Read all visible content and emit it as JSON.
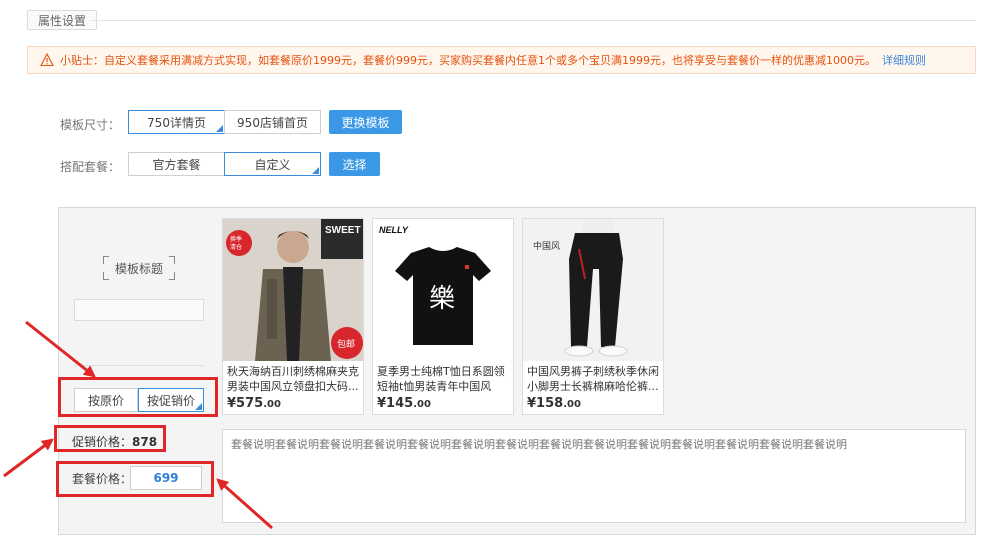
{
  "section": {
    "title": "属性设置"
  },
  "tip": {
    "text": "小贴士：自定义套餐采用满减方式实现，如套餐原价1999元，套餐价999元，买家购买套餐内任意1个或多个宝贝满1999元，也将享受与套餐价一样的优惠减1000元。",
    "link": "详细规则"
  },
  "template_size": {
    "label": "模板尺寸：",
    "options": [
      "750详情页",
      "950店铺首页"
    ],
    "selected": "750详情页",
    "button": "更换模板"
  },
  "bundle": {
    "label": "搭配套餐：",
    "options": [
      "官方套餐",
      "自定义"
    ],
    "selected": "自定义",
    "button": "选择"
  },
  "panel": {
    "template_title": "模板标题",
    "price_modes": [
      "按原价",
      "按促销价"
    ],
    "price_mode_selected": "按促销价",
    "promo_price_label": "促销价格：",
    "promo_price_value": "878",
    "package_price_label": "套餐价格：",
    "package_price_value": "699",
    "description": "套餐说明套餐说明套餐说明套餐说明套餐说明套餐说明套餐说明套餐说明套餐说明套餐说明套餐说明套餐说明套餐说明套餐说明"
  },
  "products": [
    {
      "name": "秋天海纳百川刺绣棉麻夹克男装中国风立领盘扣大码...",
      "price_int": "575",
      "price_dec": ".00",
      "currency": "¥",
      "badge_top": "换季 清仓",
      "badge_bottom": "包邮",
      "label_sweet": "SWEET"
    },
    {
      "name": "夏季男士纯棉T恤日系圆领短袖t恤男装青年中国风",
      "price_int": "145",
      "price_dec": ".00",
      "currency": "¥",
      "brand": "NELLY",
      "glyph": "樂"
    },
    {
      "name": "中国风男裤子刺绣秋季休闲小脚男士长裤棉麻哈伦裤...",
      "price_int": "158",
      "price_dec": ".00",
      "currency": "¥",
      "glyph": "中国风"
    }
  ],
  "colors": {
    "accent": "#3a98e6",
    "tip": "#e4530e",
    "annotation": "#e02626"
  }
}
